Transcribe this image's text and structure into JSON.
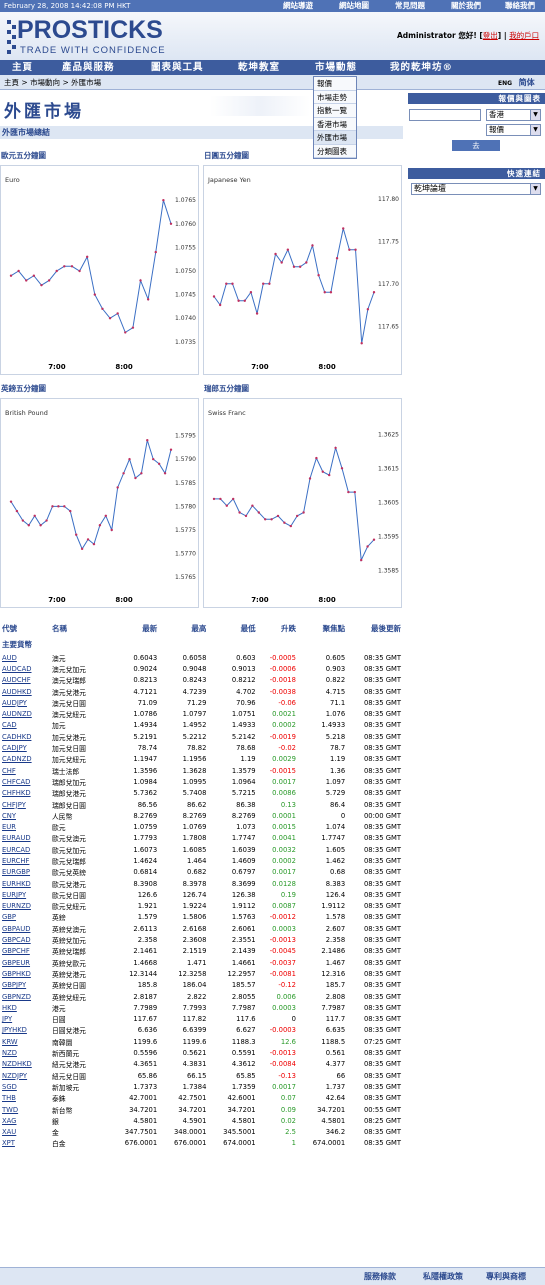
{
  "topbar": {
    "date": "February 28, 2008 14:42:08 PM HKT",
    "links": [
      "網站導遊",
      "網站地圖",
      "常見問題",
      "關於我們",
      "聯絡我們"
    ]
  },
  "logo": {
    "title": "PROSTICKS",
    "tagline": "TRADE WITH CONFIDENCE"
  },
  "user": {
    "greeting": "Administrator 您好!",
    "logout": "登出",
    "profile": "我的戶口"
  },
  "nav": {
    "items": [
      "主頁",
      "產品與服務",
      "圖表與工具",
      "乾坤教室",
      "市場動態",
      "我的乾坤坊®"
    ]
  },
  "breadcrumb": {
    "home": "主頁",
    "sep1": " > ",
    "section": "市場動向",
    "sep2": " > ",
    "current": "外匯市場"
  },
  "lang": {
    "eng": "ENG",
    "chs": "简体"
  },
  "dropdown": {
    "items": [
      "報價",
      "市場走勢",
      "指數一覽",
      "香港市場",
      "外匯市場",
      "分類圖表"
    ]
  },
  "page": {
    "title": "外匯市場",
    "section": "外匯市場總結"
  },
  "charts": {
    "eur": {
      "header": "歐元五分鐘圖",
      "name": "Euro"
    },
    "jpy": {
      "header": "日圓五分鐘圖",
      "name": "Japanese Yen"
    },
    "gbp": {
      "header": "英鎊五分鐘圖",
      "name": "British Pound"
    },
    "chf": {
      "header": "瑞郎五分鐘圖",
      "name": "Swiss Franc"
    }
  },
  "chart_data": [
    {
      "type": "line",
      "title": "Euro",
      "categories_label": [
        "7:00",
        "8:00"
      ],
      "y_ticks": [
        "1.0765",
        "1.0760",
        "1.0755",
        "1.0750",
        "1.0745",
        "1.0740",
        "1.0735"
      ],
      "ylim": [
        1.0732,
        1.0768
      ],
      "values": [
        1.0749,
        1.075,
        1.0748,
        1.0749,
        1.0747,
        1.0748,
        1.075,
        1.0751,
        1.0751,
        1.075,
        1.0753,
        1.0745,
        1.0742,
        1.074,
        1.0741,
        1.0737,
        1.0738,
        1.0748,
        1.0744,
        1.0754,
        1.0765,
        1.076
      ]
    },
    {
      "type": "line",
      "title": "Japanese Yen",
      "categories_label": [
        "7:00",
        "8:00"
      ],
      "y_ticks": [
        "117.80",
        "117.75",
        "117.70",
        "117.65"
      ],
      "ylim": [
        117.615,
        117.815
      ],
      "values": [
        117.685,
        117.675,
        117.7,
        117.7,
        117.68,
        117.68,
        117.69,
        117.665,
        117.7,
        117.7,
        117.735,
        117.725,
        117.74,
        117.72,
        117.72,
        117.725,
        117.745,
        117.71,
        117.69,
        117.69,
        117.73,
        117.765,
        117.74,
        117.74,
        117.63,
        117.67,
        117.69
      ]
    },
    {
      "type": "line",
      "title": "British Pound",
      "categories_label": [
        "7:00",
        "8:00"
      ],
      "y_ticks": [
        "1.5795",
        "1.5790",
        "1.5785",
        "1.5780",
        "1.5775",
        "1.5770",
        "1.5765"
      ],
      "ylim": [
        1.57625,
        1.57985
      ],
      "values": [
        1.5781,
        1.5779,
        1.5777,
        1.5776,
        1.5778,
        1.5776,
        1.5777,
        1.578,
        1.578,
        1.578,
        1.5779,
        1.5774,
        1.5771,
        1.5773,
        1.5772,
        1.5776,
        1.5778,
        1.5775,
        1.5784,
        1.5787,
        1.579,
        1.5786,
        1.5787,
        1.5794,
        1.579,
        1.5789,
        1.5787,
        1.5792
      ]
    },
    {
      "type": "line",
      "title": "Swiss Franc",
      "categories_label": [
        "7:00",
        "8:00"
      ],
      "y_ticks": [
        "1.3625",
        "1.3615",
        "1.3605",
        "1.3595",
        "1.3585"
      ],
      "ylim": [
        1.35795,
        1.36295
      ],
      "values": [
        1.3606,
        1.3606,
        1.3604,
        1.3606,
        1.3602,
        1.3601,
        1.3604,
        1.3602,
        1.36,
        1.36,
        1.3601,
        1.3599,
        1.3598,
        1.3601,
        1.3602,
        1.3612,
        1.3618,
        1.3614,
        1.3613,
        1.3621,
        1.3615,
        1.3608,
        1.3608,
        1.3588,
        1.3592,
        1.3594
      ]
    }
  ],
  "rpanel": {
    "quote_header": "報價與圖表",
    "market": "香港",
    "type": "報價",
    "go": "去",
    "quick_header": "快速連結",
    "quick_select": "乾坤論壇"
  },
  "table": {
    "headers": {
      "code": "代號",
      "name": "名稱",
      "last": "最新",
      "high": "最高",
      "low": "最低",
      "change": "升跌",
      "close": "聚焦點",
      "time": "最後更新"
    },
    "group": "主要貨幣",
    "rows": [
      [
        "AUD",
        "澳元",
        "0.6043",
        "0.6058",
        "0.603",
        "-0.0005",
        "0.605",
        "08:35 GMT"
      ],
      [
        "AUDCAD",
        "澳元兌加元",
        "0.9024",
        "0.9048",
        "0.9013",
        "-0.0006",
        "0.903",
        "08:35 GMT"
      ],
      [
        "AUDCHF",
        "澳元兌瑞郎",
        "0.8213",
        "0.8243",
        "0.8212",
        "-0.0018",
        "0.822",
        "08:35 GMT"
      ],
      [
        "AUDHKD",
        "澳元兌港元",
        "4.7121",
        "4.7239",
        "4.702",
        "-0.0038",
        "4.715",
        "08:35 GMT"
      ],
      [
        "AUDJPY",
        "澳元兌日圓",
        "71.09",
        "71.29",
        "70.96",
        "-0.06",
        "71.1",
        "08:35 GMT"
      ],
      [
        "AUDNZD",
        "澳元兌紐元",
        "1.0786",
        "1.0797",
        "1.0751",
        "0.0021",
        "1.076",
        "08:35 GMT"
      ],
      [
        "CAD",
        "加元",
        "1.4934",
        "1.4952",
        "1.4933",
        "0.0002",
        "1.4933",
        "08:35 GMT"
      ],
      [
        "CADHKD",
        "加元兌港元",
        "5.2191",
        "5.2212",
        "5.2142",
        "-0.0019",
        "5.218",
        "08:35 GMT"
      ],
      [
        "CADJPY",
        "加元兌日圓",
        "78.74",
        "78.82",
        "78.68",
        "-0.02",
        "78.7",
        "08:35 GMT"
      ],
      [
        "CADNZD",
        "加元兌紐元",
        "1.1947",
        "1.1956",
        "1.19",
        "0.0029",
        "1.19",
        "08:35 GMT"
      ],
      [
        "CHF",
        "瑞士法郎",
        "1.3596",
        "1.3628",
        "1.3579",
        "-0.0015",
        "1.36",
        "08:35 GMT"
      ],
      [
        "CHFCAD",
        "瑞郎兌加元",
        "1.0984",
        "1.0995",
        "1.0964",
        "0.0017",
        "1.097",
        "08:35 GMT"
      ],
      [
        "CHFHKD",
        "瑞郎兌港元",
        "5.7362",
        "5.7408",
        "5.7215",
        "0.0086",
        "5.729",
        "08:35 GMT"
      ],
      [
        "CHFJPY",
        "瑞郎兌日圓",
        "86.56",
        "86.62",
        "86.38",
        "0.13",
        "86.4",
        "08:35 GMT"
      ],
      [
        "CNY",
        "人民幣",
        "8.2769",
        "8.2769",
        "8.2769",
        "0.0001",
        "0",
        "00:00 GMT"
      ],
      [
        "EUR",
        "歐元",
        "1.0759",
        "1.0769",
        "1.073",
        "0.0015",
        "1.074",
        "08:35 GMT"
      ],
      [
        "EURAUD",
        "歐元兌澳元",
        "1.7793",
        "1.7808",
        "1.7747",
        "0.0041",
        "1.7747",
        "08:35 GMT"
      ],
      [
        "EURCAD",
        "歐元兌加元",
        "1.6073",
        "1.6085",
        "1.6039",
        "0.0032",
        "1.605",
        "08:35 GMT"
      ],
      [
        "EURCHF",
        "歐元兌瑞郎",
        "1.4624",
        "1.464",
        "1.4609",
        "0.0002",
        "1.462",
        "08:35 GMT"
      ],
      [
        "EURGBP",
        "歐元兌英鎊",
        "0.6814",
        "0.682",
        "0.6797",
        "0.0017",
        "0.68",
        "08:35 GMT"
      ],
      [
        "EURHKD",
        "歐元兌港元",
        "8.3908",
        "8.3978",
        "8.3699",
        "0.0128",
        "8.383",
        "08:35 GMT"
      ],
      [
        "EURJPY",
        "歐元兌日圓",
        "126.6",
        "126.74",
        "126.38",
        "0.19",
        "126.4",
        "08:35 GMT"
      ],
      [
        "EURNZD",
        "歐元兌紐元",
        "1.921",
        "1.9224",
        "1.9112",
        "0.0087",
        "1.9112",
        "08:35 GMT"
      ],
      [
        "GBP",
        "英鎊",
        "1.579",
        "1.5806",
        "1.5763",
        "-0.0012",
        "1.578",
        "08:35 GMT"
      ],
      [
        "GBPAUD",
        "英鎊兌澳元",
        "2.6113",
        "2.6168",
        "2.6061",
        "0.0003",
        "2.607",
        "08:35 GMT"
      ],
      [
        "GBPCAD",
        "英鎊兌加元",
        "2.358",
        "2.3608",
        "2.3551",
        "-0.0013",
        "2.358",
        "08:35 GMT"
      ],
      [
        "GBPCHF",
        "英鎊兌瑞郎",
        "2.1461",
        "2.1519",
        "2.1439",
        "-0.0045",
        "2.1486",
        "08:35 GMT"
      ],
      [
        "GBPEUR",
        "英鎊兌歐元",
        "1.4668",
        "1.471",
        "1.4661",
        "-0.0037",
        "1.467",
        "08:35 GMT"
      ],
      [
        "GBPHKD",
        "英鎊兌港元",
        "12.3144",
        "12.3258",
        "12.2957",
        "-0.0081",
        "12.316",
        "08:35 GMT"
      ],
      [
        "GBPJPY",
        "英鎊兌日圓",
        "185.8",
        "186.04",
        "185.57",
        "-0.12",
        "185.7",
        "08:35 GMT"
      ],
      [
        "GBPNZD",
        "英鎊兌紐元",
        "2.8187",
        "2.822",
        "2.8055",
        "0.006",
        "2.808",
        "08:35 GMT"
      ],
      [
        "HKD",
        "港元",
        "7.7989",
        "7.7993",
        "7.7987",
        "0.0003",
        "7.7987",
        "08:35 GMT"
      ],
      [
        "JPY",
        "日圓",
        "117.67",
        "117.82",
        "117.6",
        "0",
        "117.7",
        "08:35 GMT"
      ],
      [
        "JPYHKD",
        "日圓兌港元",
        "6.636",
        "6.6399",
        "6.627",
        "-0.0003",
        "6.635",
        "08:35 GMT"
      ],
      [
        "KRW",
        "南韓圜",
        "1199.6",
        "1199.6",
        "1188.3",
        "12.6",
        "1188.5",
        "07:25 GMT"
      ],
      [
        "NZD",
        "新西蘭元",
        "0.5596",
        "0.5621",
        "0.5591",
        "-0.0013",
        "0.561",
        "08:35 GMT"
      ],
      [
        "NZDHKD",
        "紐元兌港元",
        "4.3651",
        "4.3831",
        "4.3612",
        "-0.0084",
        "4.377",
        "08:35 GMT"
      ],
      [
        "NZDJPY",
        "紐元兌日圓",
        "65.86",
        "66.15",
        "65.85",
        "-0.13",
        "66",
        "08:35 GMT"
      ],
      [
        "SGD",
        "新加坡元",
        "1.7373",
        "1.7384",
        "1.7359",
        "0.0017",
        "1.737",
        "08:35 GMT"
      ],
      [
        "THB",
        "泰銖",
        "42.7001",
        "42.7501",
        "42.6001",
        "0.07",
        "42.64",
        "08:35 GMT"
      ],
      [
        "TWD",
        "新台幣",
        "34.7201",
        "34.7201",
        "34.7201",
        "0.09",
        "34.7201",
        "00:55 GMT"
      ],
      [
        "XAG",
        "銀",
        "4.5801",
        "4.5901",
        "4.5801",
        "0.02",
        "4.5801",
        "08:25 GMT"
      ],
      [
        "XAU",
        "金",
        "347.7501",
        "348.0001",
        "345.5001",
        "2.5",
        "346.2",
        "08:35 GMT"
      ],
      [
        "XPT",
        "白金",
        "676.0001",
        "676.0001",
        "674.0001",
        "1",
        "674.0001",
        "08:35 GMT"
      ]
    ]
  },
  "footer": {
    "links": [
      "服務條款",
      "私隱權政策",
      "專利與商標"
    ]
  },
  "colors": {
    "nav": "#3d5c9e",
    "accent": "#2c4a8f",
    "negative": "#e00000",
    "positive": "#2a9a2a"
  }
}
